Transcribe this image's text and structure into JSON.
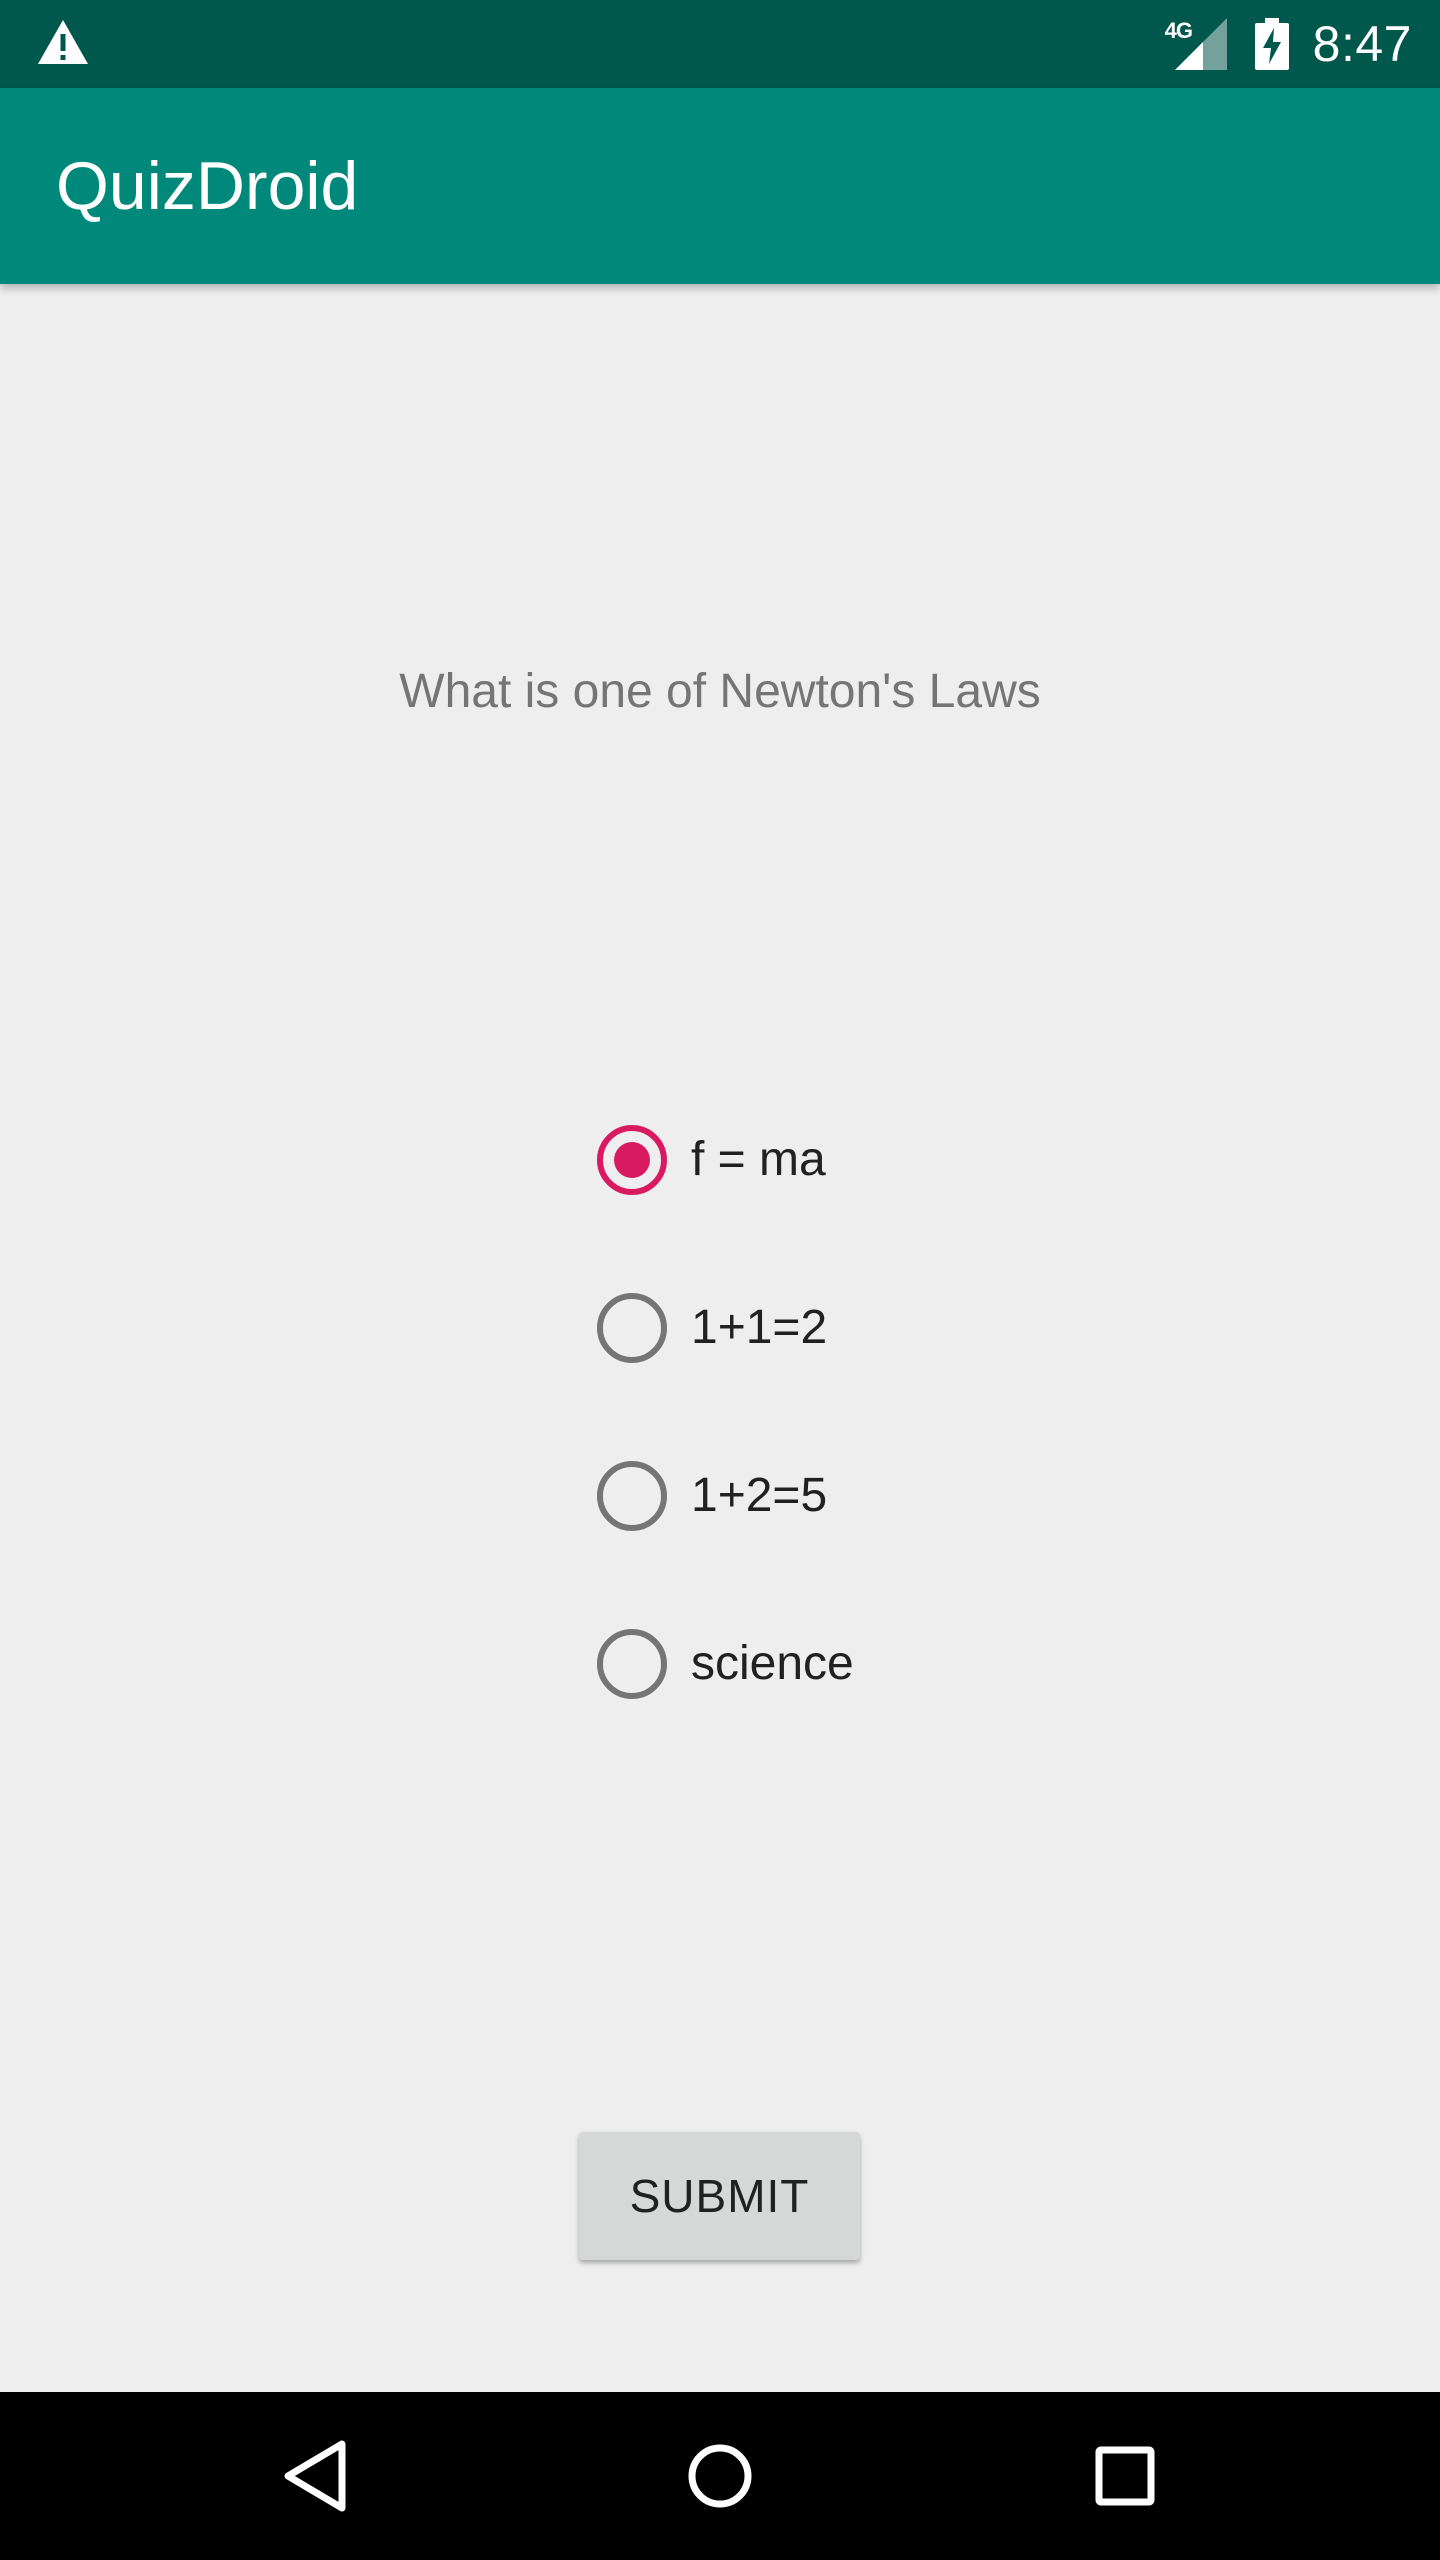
{
  "status_bar": {
    "network_type": "4G",
    "time": "8:47",
    "icons": [
      "warning-icon",
      "signal-icon",
      "battery-charging-icon"
    ]
  },
  "app_bar": {
    "title": "QuizDroid"
  },
  "question": {
    "text": "What is one of Newton's Laws"
  },
  "options": [
    {
      "label": "f = ma",
      "checked": true
    },
    {
      "label": "1+1=2",
      "checked": false
    },
    {
      "label": "1+2=5",
      "checked": false
    },
    {
      "label": "science",
      "checked": false
    }
  ],
  "submit": {
    "label": "SUBMIT"
  },
  "nav_bar": {
    "icons": [
      "back-icon",
      "home-icon",
      "recents-icon"
    ]
  },
  "colors": {
    "status_bar": "#00574B",
    "app_bar": "#00897B",
    "accent": "#D81B60",
    "background": "#EEEEEE"
  }
}
